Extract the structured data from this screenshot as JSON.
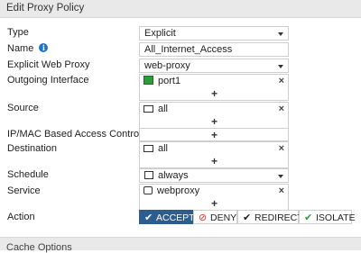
{
  "header": {
    "title": "Edit Proxy Policy"
  },
  "form": {
    "type": {
      "label": "Type",
      "value": "Explicit"
    },
    "name": {
      "label": "Name",
      "value": "All_Internet_Access"
    },
    "explicit_web_proxy": {
      "label": "Explicit Web Proxy",
      "value": "web-proxy"
    },
    "outgoing_interface": {
      "label": "Outgoing Interface",
      "value": "port1"
    },
    "source": {
      "label": "Source",
      "value": "all"
    },
    "ip_mac": {
      "label": "IP/MAC Based Access Control"
    },
    "destination": {
      "label": "Destination",
      "value": "all"
    },
    "schedule": {
      "label": "Schedule",
      "value": "always"
    },
    "service": {
      "label": "Service",
      "value": "webproxy"
    },
    "action": {
      "label": "Action",
      "options": [
        "ACCEPT",
        "DENY",
        "REDIRECT",
        "ISOLATE"
      ],
      "selected": "ACCEPT"
    }
  },
  "cache": {
    "title": "Cache Options"
  },
  "icons": {
    "remove": "×",
    "add": "+"
  },
  "colors": {
    "accent": "#2d5c8f",
    "info": "#1f73c9",
    "deny": "#d9372c",
    "isolate": "#2e9b3b",
    "interface": "#2e9b3b"
  }
}
